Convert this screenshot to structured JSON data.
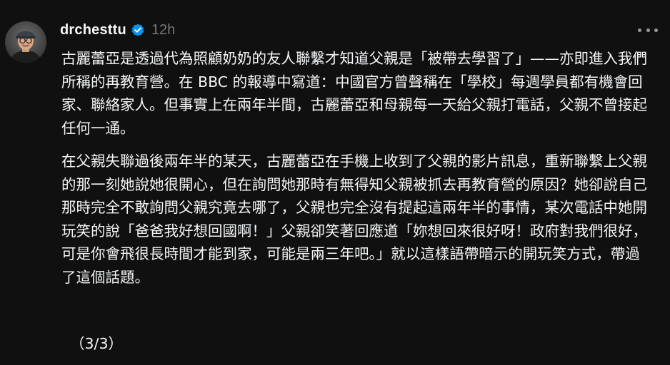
{
  "post": {
    "author": {
      "username": "drchesttu",
      "verified": true
    },
    "timestamp": "12h",
    "paragraphs": [
      "古麗蕾亞是透過代為照顧奶奶的友人聯繫才知道父親是「被帶去學習了」——亦即進入我們所稱的再教育營。在 BBC 的報導中寫道：中國官方曾聲稱在「學校」每週學員都有機會回家、聯絡家人。但事實上在兩年半間，古麗蕾亞和母親每一天給父親打電話，父親不曾接起任何一通。",
      "在父親失聯過後兩年半的某天，古麗蕾亞在手機上收到了父親的影片訊息，重新聯繫上父親的那一刻她說她很開心，但在詢問她那時有無得知父親被抓去再教育營的原因？她卻說自己那時完全不敢詢問父親究竟去哪了，父親也完全沒有提起這兩年半的事情，某次電話中她開玩笑的說「爸爸我好想回國啊！」父親卻笑著回應道「妳想回來很好呀！政府對我們很好，可是你會飛很長時間才能到家，可能是兩三年吧。」就以這樣語帶暗示的開玩笑方式，帶過了這個話題。"
    ],
    "page_indicator": "（3/3）"
  },
  "icons": {
    "verified": "verified-badge-icon",
    "more": "more-options-icon",
    "avatar": "avatar"
  },
  "colors": {
    "background": "#101010",
    "text": "#f3f5f7",
    "muted": "#777777",
    "verified_blue": "#0095f6"
  }
}
